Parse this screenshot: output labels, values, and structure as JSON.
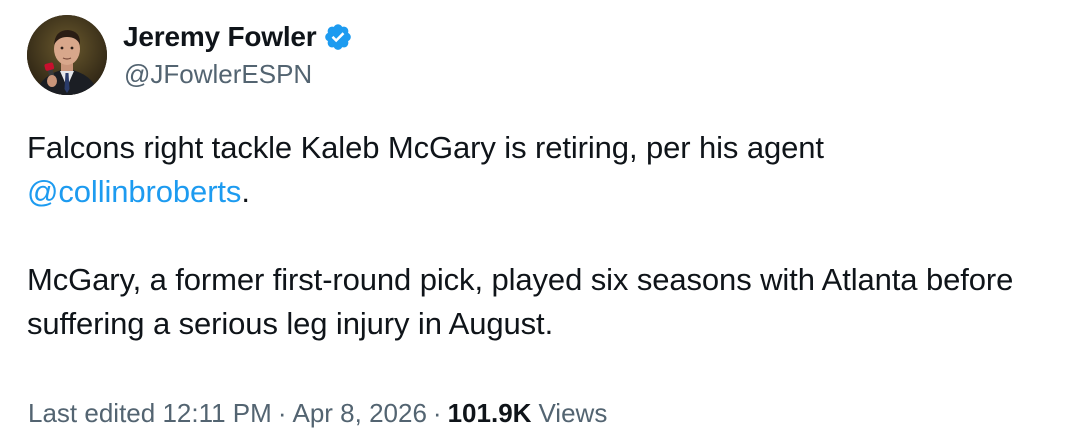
{
  "author": {
    "display_name": "Jeremy Fowler",
    "handle": "@JFowlerESPN",
    "verified_icon": "verified-badge-icon"
  },
  "tweet": {
    "line1_text": "Falcons right tackle Kaleb McGary is retiring, per his agent",
    "mention": "@collinbroberts",
    "mention_suffix": ".",
    "paragraph2": "McGary, a former first-round pick, played six seasons with Atlanta before suffering a serious leg injury in August."
  },
  "meta": {
    "edited_label": "Last edited",
    "time": "12:11 PM",
    "separator": "·",
    "date": "Apr 8, 2026",
    "views_count": "101.9K",
    "views_label": "Views"
  },
  "colors": {
    "text_primary": "#0f1419",
    "text_secondary": "#536471",
    "link": "#1d9bf0",
    "verified": "#1d9bf0"
  }
}
